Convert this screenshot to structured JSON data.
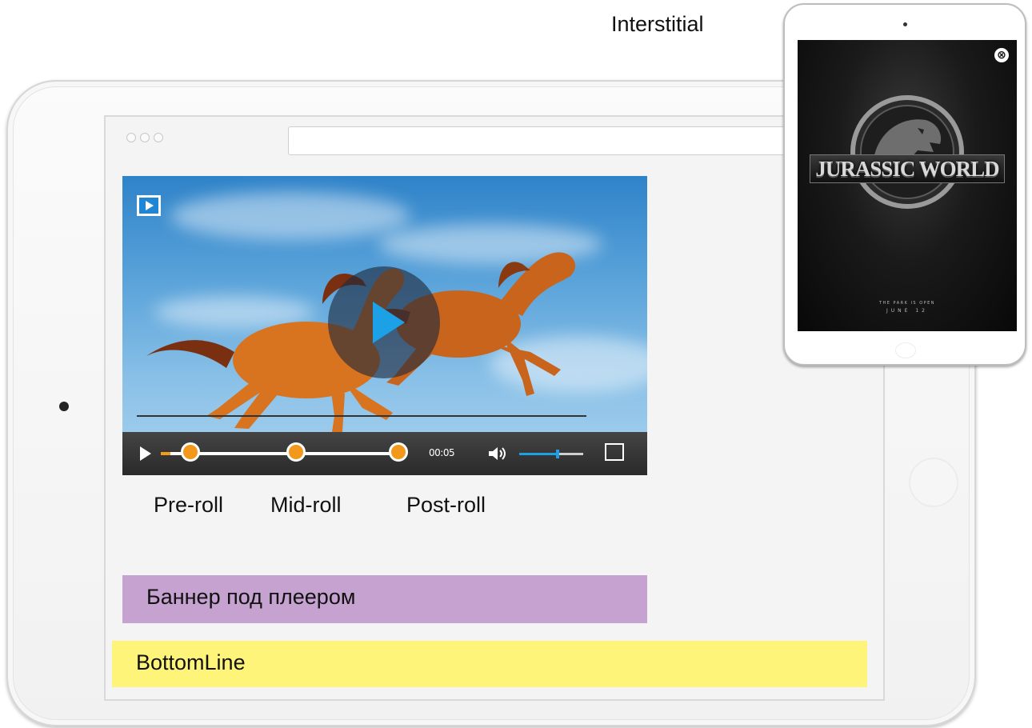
{
  "interstitial": {
    "label": "Interstitial",
    "poster_title": "JURASSIC WORLD",
    "poster_tagline": "THE PARK IS OPEN",
    "poster_date": "JUNE 12",
    "close_glyph": "⊗"
  },
  "player": {
    "time": "00:05",
    "ad_markers": [
      {
        "name": "pre-roll",
        "label": "Pre-roll"
      },
      {
        "name": "mid-roll",
        "label": "Mid-roll"
      },
      {
        "name": "post-roll",
        "label": "Post-roll"
      }
    ],
    "volume_level": 0.6,
    "icons": [
      "play-icon",
      "volume-icon",
      "fullscreen-icon",
      "player-logo-icon"
    ]
  },
  "banners": {
    "under_player": "Баннер под плеером",
    "bottom_line": "BottomLine"
  },
  "colors": {
    "banner_under_player": "#c6a2d0",
    "bottom_line": "#fff47a",
    "ad_marker": "#f2981a",
    "accent": "#1ca0e6"
  }
}
